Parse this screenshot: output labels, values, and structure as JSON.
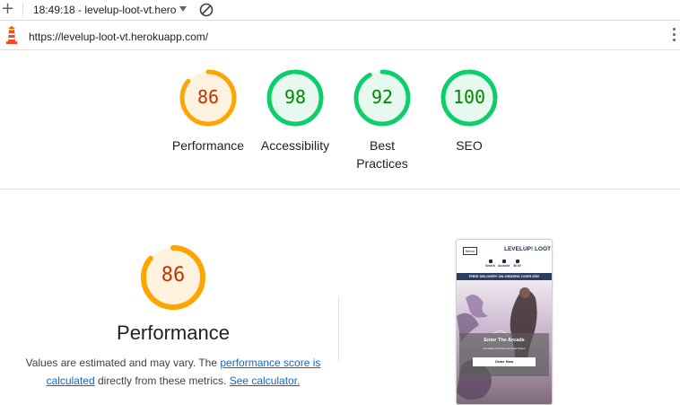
{
  "tab": {
    "title": "18:49:18 - levelup-loot-vt.hero"
  },
  "url": "https://levelup-loot-vt.herokuapp.com/",
  "colors": {
    "orange": "#ffa400",
    "green": "#0cce6b",
    "orange_text": "#c33300",
    "green_text": "#008800"
  },
  "gauges": [
    {
      "score": "86",
      "label": "Performance",
      "fraction": 0.86
    },
    {
      "score": "98",
      "label": "Accessibility",
      "fraction": 0.98
    },
    {
      "score": "92",
      "label": "Best Practices",
      "fraction": 0.92
    },
    {
      "score": "100",
      "label": "SEO",
      "fraction": 1.0
    }
  ],
  "performance": {
    "score": "86",
    "fraction": 0.86,
    "title": "Performance",
    "desc_start": "Values are estimated and may vary. The ",
    "link1": "performance score is calculated",
    "desc_mid": " directly from these metrics. ",
    "link2": "See calculator."
  },
  "thumbnail": {
    "menu": "Menu",
    "logo": "LEVELUP! LOOT",
    "icons": [
      "Search",
      "Account",
      "$0.00"
    ],
    "banner": "FREE DELIVERY ON ORDERS OVER €50!",
    "hero_title": "Enter The Arcade",
    "hero_sub": "Get Retro Products At Great Prices",
    "button": "Order Now"
  }
}
